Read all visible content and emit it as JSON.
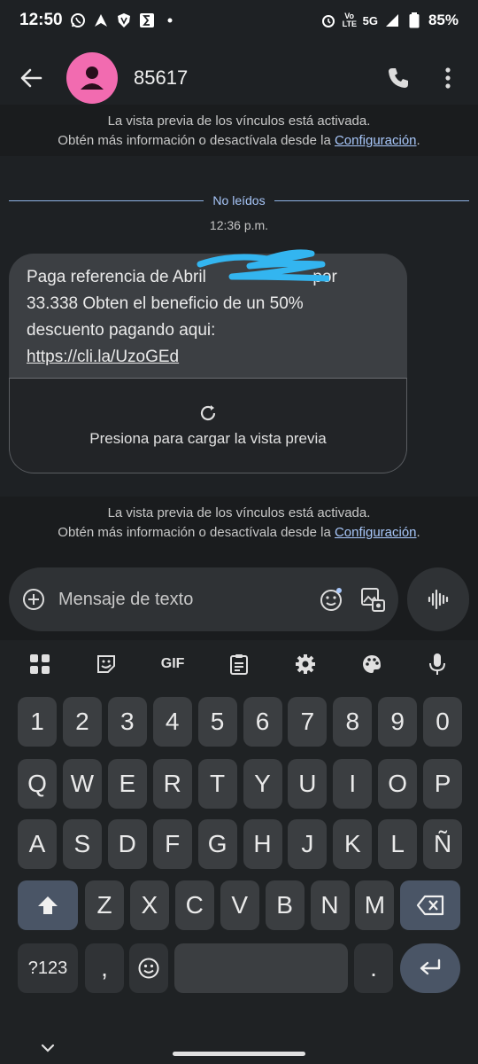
{
  "status_bar": {
    "time": "12:50",
    "network": "5G",
    "volte": "Vo LTE",
    "battery": "85%"
  },
  "app_bar": {
    "contact": "85617"
  },
  "banner": {
    "line1": "La vista previa de los vínculos está activada.",
    "line2_prefix": "Obtén más información o desactívala desde la ",
    "link": "Configuración",
    "line2_suffix": "."
  },
  "conversation": {
    "unread_label": "No leídos",
    "timestamp": "12:36 p.m.",
    "message": {
      "line1": "Paga referencia de Abril ",
      "line1_tail": " por",
      "line2": "33.338 Obten el beneficio de un 50%",
      "line3": "descuento pagando aqui:",
      "url": "https://cli.la/UzoGEd"
    },
    "preview_label": "Presiona para cargar la vista previa"
  },
  "compose": {
    "placeholder": "Mensaje de texto"
  },
  "keyboard": {
    "toolbar": [
      "apps-icon",
      "sticker-icon",
      "GIF",
      "clipboard-icon",
      "settings-icon",
      "palette-icon",
      "mic-icon"
    ],
    "gif_label": "GIF",
    "row_numbers": [
      "1",
      "2",
      "3",
      "4",
      "5",
      "6",
      "7",
      "8",
      "9",
      "0"
    ],
    "row1": [
      "Q",
      "W",
      "E",
      "R",
      "T",
      "Y",
      "U",
      "I",
      "O",
      "P"
    ],
    "row2": [
      "A",
      "S",
      "D",
      "F",
      "G",
      "H",
      "J",
      "K",
      "L",
      "Ñ"
    ],
    "row3": [
      "Z",
      "X",
      "C",
      "V",
      "B",
      "N",
      "M"
    ],
    "symbols_label": "?123",
    "comma": ",",
    "period": "."
  },
  "colors": {
    "accent": "#a8c7fa",
    "avatar": "#f26bb0",
    "scribble": "#33b5f0"
  }
}
